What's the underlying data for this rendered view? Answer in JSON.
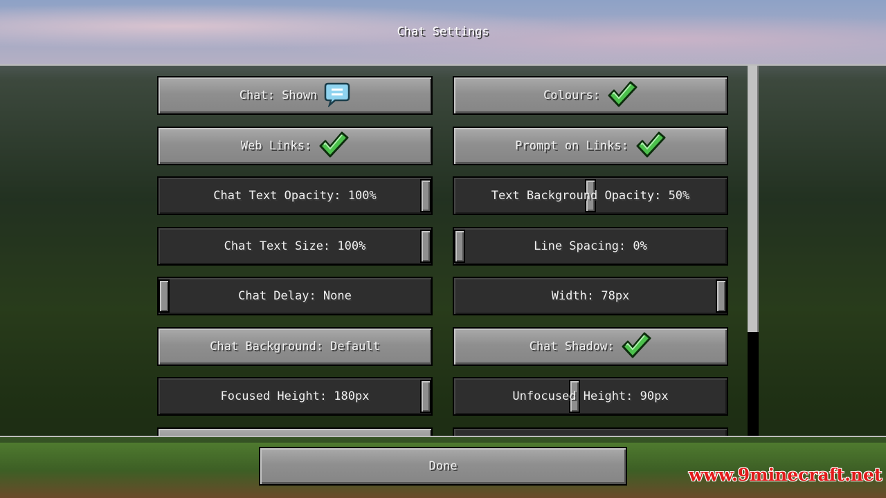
{
  "screen_title": "Chat Settings",
  "options": {
    "chat": {
      "label": "Chat: Shown",
      "icon": "chat-bubble-icon"
    },
    "colours": {
      "label": "Colours:",
      "icon": "checkmark-icon"
    },
    "web_links": {
      "label": "Web Links:",
      "icon": "checkmark-icon"
    },
    "prompt_on_links": {
      "label": "Prompt on Links:",
      "icon": "checkmark-icon"
    },
    "chat_text_opacity": {
      "label": "Chat Text Opacity: 100%",
      "value": 1.0
    },
    "text_bg_opacity": {
      "label": "Text Background Opacity: 50%",
      "value": 0.5
    },
    "chat_text_size": {
      "label": "Chat Text Size: 100%",
      "value": 1.0
    },
    "line_spacing": {
      "label": "Line Spacing: 0%",
      "value": 0.0
    },
    "chat_delay": {
      "label": "Chat Delay: None",
      "value": 0.0
    },
    "width": {
      "label": "Width: 78px",
      "value": 1.0
    },
    "chat_background": {
      "label": "Chat Background: Default"
    },
    "chat_shadow": {
      "label": "Chat Shadow:",
      "icon": "checkmark-icon"
    },
    "focused_height": {
      "label": "Focused Height: 180px",
      "value": 1.0
    },
    "unfocused_height": {
      "label": "Unfocused Height: 90px",
      "value": 0.44
    }
  },
  "scrollbar": {
    "position": 0.0,
    "visible_fraction": 0.72
  },
  "done_label": "Done",
  "watermark": "www.9minecraft.net",
  "colors": {
    "checkmark": "#4cc14c",
    "chat_bubble": "#8fd3ef",
    "watermark": "#e11b1b"
  }
}
